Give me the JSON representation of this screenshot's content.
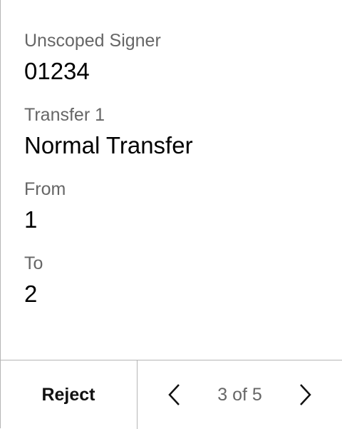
{
  "fields": [
    {
      "label": "Unscoped Signer",
      "value": "01234"
    },
    {
      "label": "Transfer 1",
      "value": "Normal Transfer"
    },
    {
      "label": "From",
      "value": "1"
    },
    {
      "label": "To",
      "value": "2"
    }
  ],
  "footer": {
    "reject_label": "Reject",
    "pager": {
      "current": 3,
      "total": 5,
      "text": "3 of 5",
      "prev_icon": "chevron-left-icon",
      "next_icon": "chevron-right-icon"
    }
  }
}
